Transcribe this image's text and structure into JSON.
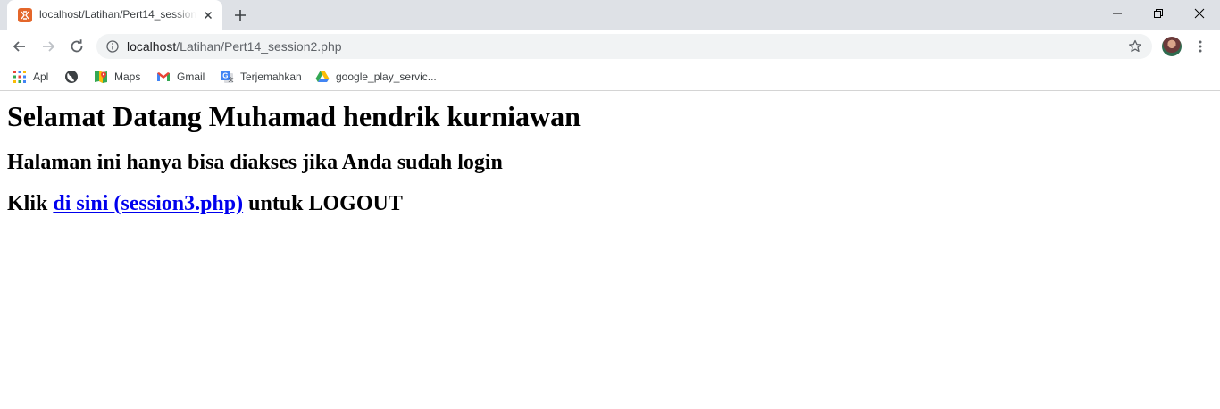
{
  "browser": {
    "tab": {
      "title": "localhost/Latihan/Pert14_session2.php",
      "favicon": "xampp-icon"
    },
    "address_bar": {
      "host": "localhost",
      "path": "/Latihan/Pert14_session2.php"
    },
    "bookmarks": [
      {
        "label": "Apl",
        "icon": "apps-grid-icon"
      },
      {
        "label": "",
        "icon": "globe-icon"
      },
      {
        "label": "Maps",
        "icon": "maps-icon"
      },
      {
        "label": "Gmail",
        "icon": "gmail-icon"
      },
      {
        "label": "Terjemahkan",
        "icon": "translate-icon"
      },
      {
        "label": "google_play_servic...",
        "icon": "google-drive-icon"
      }
    ],
    "colors": {
      "tab_strip": "#dee1e6",
      "omnibox": "#f1f3f4",
      "favicon": "#e4662a"
    }
  },
  "page": {
    "heading": "Selamat Datang Muhamad hendrik kurniawan",
    "subheading": "Halaman ini hanya bisa diakses jika Anda sudah login",
    "logout": {
      "prefix": "Klik ",
      "link_text": "di sini (session3.php)",
      "suffix": " untuk LOGOUT"
    },
    "colors": {
      "link": "#0000ee"
    }
  }
}
